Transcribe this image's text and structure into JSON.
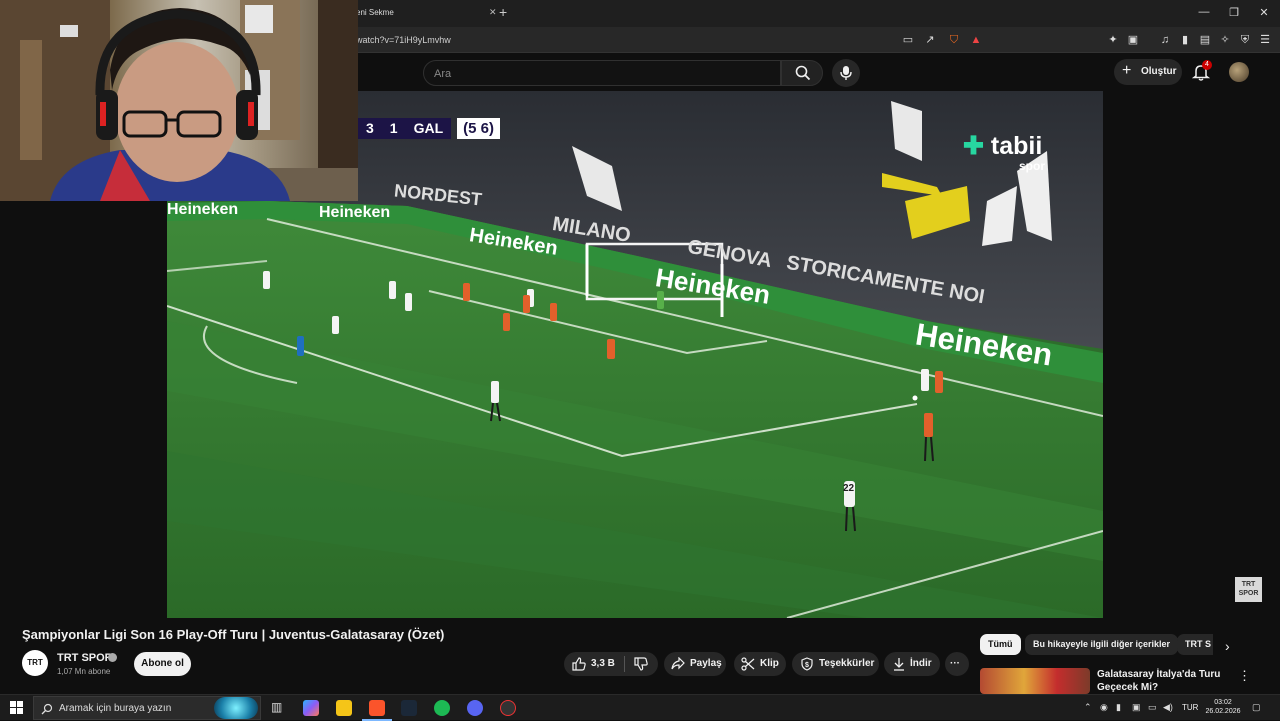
{
  "browser": {
    "tab_title": "eni Sekme",
    "url": "watch?v=71iH9yLmvhw",
    "notification_count": "4"
  },
  "youtube": {
    "search_placeholder": "Ara",
    "create_label": "Oluştur",
    "bell_badge": "4"
  },
  "video": {
    "scoreboard": {
      "home_score": "3",
      "away_score": "1",
      "away_team": "GAL",
      "aggregate": "(5 6)"
    },
    "broadcaster_logo": "tabii",
    "broadcaster_sub": "spor",
    "sponsor_text": "Heineken",
    "banner_nordest": "NORDEST",
    "banner_milano": "MILANO",
    "banner_genova": "GENOVA",
    "banner_storico": "STORICAMENTE NOI",
    "watermark": "TRT SPOR",
    "player_number": "22"
  },
  "info": {
    "title": "Şampiyonlar Ligi Son 16 Play-Off Turu | Juventus-Galatasaray (Özet)",
    "channel_avatar": "TRT",
    "channel_name": "TRT SPOR",
    "subscribers": "1,07 Mn abone",
    "subscribe_label": "Abone ol",
    "likes": "3,3 B",
    "share_label": "Paylaş",
    "clip_label": "Klip",
    "thanks_label": "Teşekkürler",
    "download_label": "İndir",
    "more_label": "···"
  },
  "sidebar": {
    "chips": [
      "Tümü",
      "Bu hikayeyle ilgili diğer içerikler",
      "TRT S"
    ],
    "rec_title": "Galatasaray İtalya'da Turu Geçecek Mi?"
  },
  "taskbar": {
    "search_placeholder": "Aramak için buraya yazın",
    "language": "TUR",
    "time": "03:02",
    "date": "26.02.2026"
  },
  "colors": {
    "yt_bg": "#0f0f0f",
    "pitch": "#2e6d2c",
    "scorebug": "#1c1446",
    "tabii_accent": "#27d6a0",
    "notify_red": "#cc0000"
  }
}
